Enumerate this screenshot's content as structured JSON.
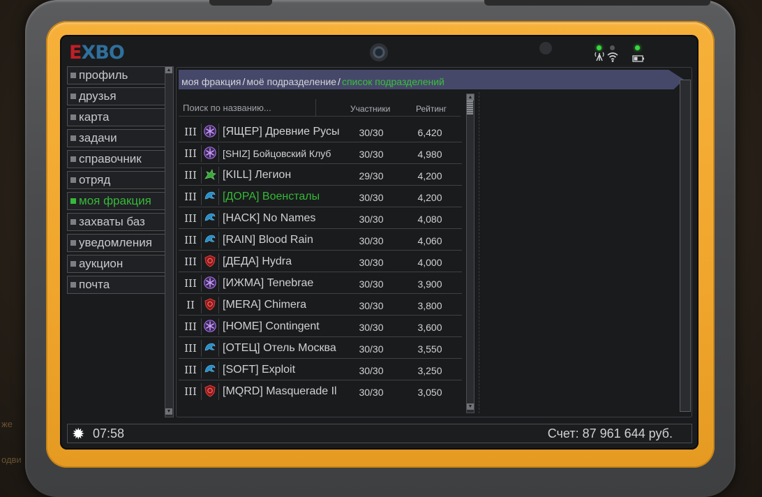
{
  "background": {
    "left_fragment_1": "же",
    "left_fragment_2": "одви"
  },
  "device": {
    "logo_left": "E",
    "logo_mid": "X",
    "logo_right": "BO"
  },
  "menu": {
    "items": [
      {
        "label": "профиль"
      },
      {
        "label": "друзья"
      },
      {
        "label": "карта"
      },
      {
        "label": "задачи"
      },
      {
        "label": "справочник"
      },
      {
        "label": "отряд"
      },
      {
        "label": "моя фракция",
        "active": true
      },
      {
        "label": "захваты баз"
      },
      {
        "label": "уведомления"
      },
      {
        "label": "аукцион"
      },
      {
        "label": "почта"
      }
    ]
  },
  "breadcrumb": {
    "part1": "моя фракция",
    "part2": "моё подразделение",
    "current": "список подразделений",
    "separator": "/"
  },
  "list": {
    "search_placeholder": "Поиск по названию...",
    "col_members": "Участники",
    "col_rating": "Рейтинг",
    "rows": [
      {
        "rank": "III",
        "emblem": "purple-snowflake-icon",
        "name": "[ЯЩЕР] Древние Русы",
        "members": "30/30",
        "rating": "6,420"
      },
      {
        "rank": "III",
        "emblem": "purple-snowflake-icon",
        "name": "[SHIZ] Бойцовский Клуб",
        "members": "30/30",
        "rating": "4,980"
      },
      {
        "rank": "III",
        "emblem": "green-dragon-icon",
        "name": "[KILL] Легион",
        "members": "29/30",
        "rating": "4,200"
      },
      {
        "rank": "III",
        "emblem": "blue-eagle-icon",
        "name": "[ДОРА] Военсталы",
        "members": "30/30",
        "rating": "4,200"
      },
      {
        "rank": "III",
        "emblem": "blue-eagle-icon",
        "name": "[HACK] No Names",
        "members": "30/30",
        "rating": "4,080"
      },
      {
        "rank": "III",
        "emblem": "blue-eagle-icon",
        "name": "[RAIN] Blood Rain",
        "members": "30/30",
        "rating": "4,060"
      },
      {
        "rank": "III",
        "emblem": "red-shield-icon",
        "name": "[ДЕДА] Hydra",
        "members": "30/30",
        "rating": "4,000"
      },
      {
        "rank": "III",
        "emblem": "purple-snowflake-icon",
        "name": "[ИЖМА] Tenebrae",
        "members": "30/30",
        "rating": "3,900"
      },
      {
        "rank": "II",
        "emblem": "red-shield-icon",
        "name": "[MERA] Chimera",
        "members": "30/30",
        "rating": "3,800"
      },
      {
        "rank": "III",
        "emblem": "purple-snowflake-icon",
        "name": "[HOME] Contingent",
        "members": "30/30",
        "rating": "3,600"
      },
      {
        "rank": "III",
        "emblem": "blue-eagle-icon",
        "name": "[ОТЕЦ] Отель Москва",
        "members": "30/30",
        "rating": "3,550"
      },
      {
        "rank": "III",
        "emblem": "blue-eagle-icon",
        "name": "[SOFT] Exploit",
        "members": "30/30",
        "rating": "3,250"
      },
      {
        "rank": "III",
        "emblem": "red-shield-icon",
        "name": "[MQRD] Masquerade Il",
        "members": "30/30",
        "rating": "3,050"
      }
    ]
  },
  "footer": {
    "time": "07:58",
    "balance": "Счет: 87 961 644 руб."
  },
  "colors": {
    "accent_green": "#36b83a",
    "bezel_orange": "#f0a52c",
    "breadcrumb_bg": "#46486a"
  }
}
